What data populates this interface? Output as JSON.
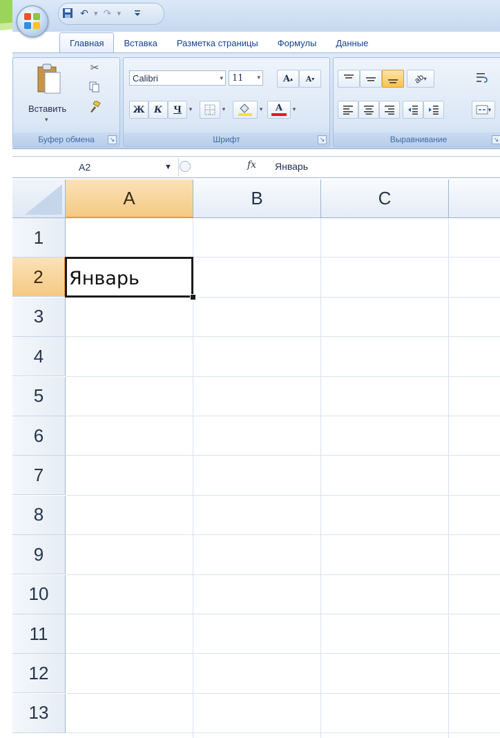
{
  "ribbon": {
    "tabs": [
      "Главная",
      "Вставка",
      "Разметка страницы",
      "Формулы",
      "Данные"
    ],
    "clipboard": {
      "paste_label": "Вставить",
      "group_label": "Буфер обмена"
    },
    "font": {
      "family": "Calibri",
      "size": "11",
      "bold": "Ж",
      "italic": "К",
      "underline": "Ч",
      "font_color_label": "A",
      "grow_label": "A",
      "shrink_label": "A",
      "group_label": "Шрифт"
    },
    "alignment": {
      "group_label": "Выравнивание"
    }
  },
  "formula_bar": {
    "name_box": "A2",
    "fx": "fx",
    "value": "Январь"
  },
  "sheet": {
    "columns": [
      "A",
      "B",
      "C"
    ],
    "rows": [
      "1",
      "2",
      "3",
      "4",
      "5",
      "6",
      "7",
      "8",
      "9",
      "10",
      "11",
      "12",
      "13"
    ],
    "selected_column": "A",
    "selected_row": "2",
    "cells": {
      "A2": "Январь"
    }
  },
  "colors": {
    "selection_header": "#f5c983",
    "ribbon_text": "#15428b",
    "accent_green": "#8cc63f"
  }
}
